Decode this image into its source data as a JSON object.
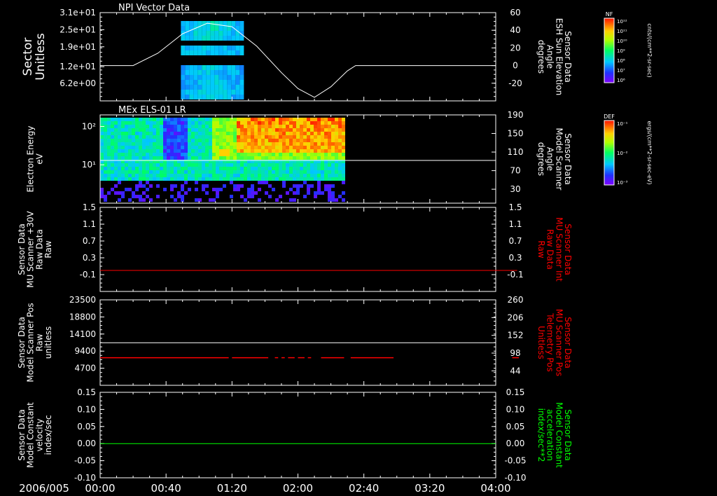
{
  "time_axis": {
    "date_label": "2006/005",
    "ticks": [
      "00:00",
      "00:40",
      "01:20",
      "02:00",
      "02:40",
      "03:20",
      "04:00"
    ],
    "range_minutes": [
      0,
      240
    ]
  },
  "chart_data": [
    {
      "type": "heatmap",
      "title": "NPI Vector Data",
      "ylabel": "Sector\nUnitless",
      "y_ticks": [
        "3.1e+01",
        "2.5e+01",
        "1.9e+01",
        "1.2e+01",
        "6.2e+00"
      ],
      "y_tick_values": [
        31,
        25,
        19,
        12,
        6.2
      ],
      "ylim": [
        0,
        31
      ],
      "colorbar": {
        "label": "NF",
        "units": "cnts/(cm**2-sr-sec)",
        "ticks": [
          "10¹²",
          "10¹¹",
          "10¹⁰",
          "10⁹",
          "10⁸",
          "10⁷",
          "10⁶"
        ]
      },
      "data_span_minutes": [
        49,
        87
      ],
      "right_axis": {
        "label": "Sensor Data\nESH Sun Elevation\nAngle\ndegrees",
        "ticks": [
          "60",
          "40",
          "20",
          "0",
          "-20"
        ],
        "tick_values": [
          60,
          40,
          20,
          0,
          -20
        ],
        "ylim": [
          -40,
          60
        ],
        "line": {
          "color": "#ffffff",
          "x": [
            0,
            20,
            35,
            50,
            65,
            80,
            95,
            110,
            120,
            130,
            140,
            150,
            155,
            165,
            240
          ],
          "y": [
            0,
            0,
            14,
            36,
            48,
            44,
            22,
            -8,
            -26,
            -36,
            -24,
            -6,
            0,
            0,
            0
          ]
        }
      }
    },
    {
      "type": "heatmap",
      "title": "MEx ELS-01 LR",
      "ylabel": "Electron Energy\neV",
      "y_ticks": [
        "10²",
        "10¹"
      ],
      "y_tick_values": [
        100,
        10
      ],
      "ylim": [
        1,
        200
      ],
      "log_scale": true,
      "colorbar": {
        "label": "DEF",
        "units": "ergs/(cm**2-sr-sec-eV)",
        "ticks": [
          "10⁻¹",
          "10⁻²",
          "10⁻³"
        ]
      },
      "data_span_minutes": [
        0,
        148
      ],
      "right_axis": {
        "label": "Sensor Data\nModel Scanner\nAngle\ndegrees",
        "ticks": [
          "190",
          "150",
          "110",
          "70",
          "30"
        ],
        "tick_values": [
          190,
          150,
          110,
          70,
          30
        ],
        "ylim": [
          0,
          190
        ],
        "line": {
          "color": "#ffffff",
          "x": [
            0,
            240
          ],
          "y": [
            92,
            92
          ]
        }
      }
    },
    {
      "type": "line",
      "ylabel": "Sensor Data\nMU Scanner +30V\nRaw Data\nRaw",
      "y_ticks": [
        "1.5",
        "1.1",
        "0.7",
        "0.3",
        "-0.1"
      ],
      "y_tick_values": [
        1.5,
        1.1,
        0.7,
        0.3,
        -0.1
      ],
      "ylim": [
        -0.5,
        1.5
      ],
      "series": [
        {
          "color": "#ff0000",
          "x": [
            0,
            253
          ],
          "y": [
            0,
            0
          ]
        }
      ],
      "right_axis": {
        "label": "Sensor Data\nMU Scanner Int\nRaw Data\nRaw",
        "label_color": "#ff0000",
        "ticks": [
          "1.5",
          "1.1",
          "0.7",
          "0.3",
          "-0.1"
        ],
        "tick_values": [
          1.5,
          1.1,
          0.7,
          0.3,
          -0.1
        ],
        "ylim": [
          -0.5,
          1.5
        ]
      }
    },
    {
      "type": "line",
      "ylabel": "Sensor Data\nModel Scanner Pos\nRaw\nunitless",
      "y_ticks": [
        "23500",
        "18800",
        "14100",
        "9400",
        "4700"
      ],
      "y_tick_values": [
        23500,
        18800,
        14100,
        9400,
        4700
      ],
      "ylim": [
        0,
        23500
      ],
      "series": [
        {
          "color": "#ffffff",
          "x": [
            0,
            240
          ],
          "y": [
            11700,
            11700
          ]
        }
      ],
      "right_axis": {
        "label": "Sensor Data\nMU Scanner Pos\nTelemetry Pos\nUnitless",
        "label_color": "#ff0000",
        "ticks": [
          "260",
          "206",
          "152",
          "98",
          "44"
        ],
        "tick_values": [
          260,
          206,
          152,
          98,
          44
        ],
        "ylim": [
          0,
          260
        ],
        "segments": {
          "color": "#ff0000",
          "y": 84,
          "spans": [
            [
              0,
              78
            ],
            [
              80,
              102
            ],
            [
              106,
              108
            ],
            [
              110,
              112
            ],
            [
              114,
              118
            ],
            [
              120,
              124
            ],
            [
              126,
              128
            ],
            [
              134,
              148
            ],
            [
              152,
              178
            ],
            [
              250,
              254
            ]
          ]
        }
      }
    },
    {
      "type": "line",
      "ylabel": "Sensor Data\nModel Constant\nvelocity\nindex/sec",
      "y_ticks": [
        "0.15",
        "0.10",
        "0.05",
        "0.00",
        "-0.05",
        "-0.10"
      ],
      "y_tick_values": [
        0.15,
        0.1,
        0.05,
        0.0,
        -0.05,
        -0.1
      ],
      "ylim": [
        -0.1,
        0.15
      ],
      "series": [
        {
          "color": "#00ff00",
          "x": [
            0,
            240
          ],
          "y": [
            0,
            0
          ]
        }
      ],
      "right_axis": {
        "label": "Sensor Data\nModel Constant\nacceleration\nindex/sec**2",
        "label_color": "#00ff00",
        "ticks": [
          "0.15",
          "0.10",
          "0.05",
          "0.00",
          "-0.05",
          "-0.10"
        ],
        "tick_values": [
          0.15,
          0.1,
          0.05,
          0.0,
          -0.05,
          -0.1
        ],
        "ylim": [
          -0.1,
          0.15
        ]
      }
    }
  ]
}
